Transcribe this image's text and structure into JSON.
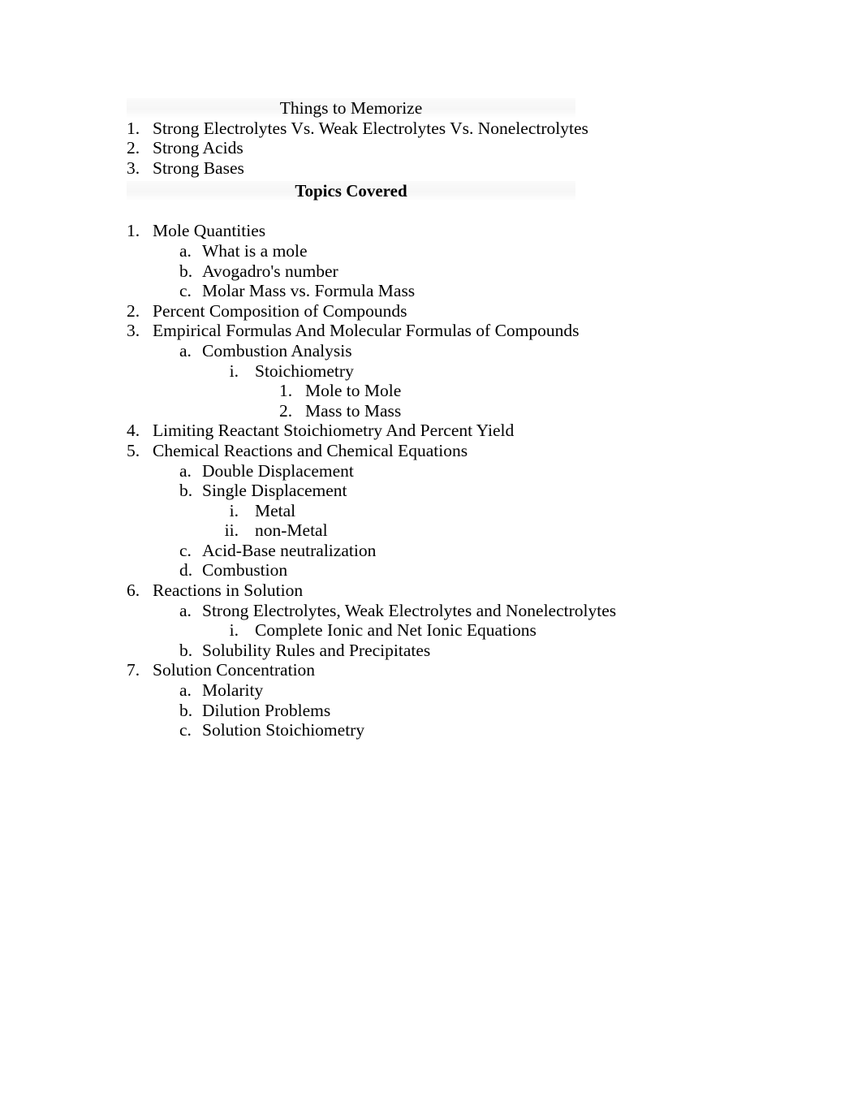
{
  "document": {
    "memorize_section": {
      "heading": "Things to Memorize",
      "items": [
        {
          "marker": "1.",
          "label": "Strong Electrolytes Vs. Weak Electrolytes Vs. Nonelectrolytes"
        },
        {
          "marker": "2.",
          "label": "Strong Acids"
        },
        {
          "marker": "3.",
          "label": "Strong Bases"
        }
      ]
    },
    "topics_section": {
      "heading": "Topics Covered",
      "items": [
        {
          "marker": "1.",
          "level": 1,
          "label": "Mole Quantities"
        },
        {
          "marker": "a.",
          "level": 2,
          "label": "What is a mole"
        },
        {
          "marker": "b.",
          "level": 2,
          "label": "Avogadro's number"
        },
        {
          "marker": "c.",
          "level": 2,
          "label": "Molar Mass vs. Formula Mass"
        },
        {
          "marker": "2.",
          "level": 1,
          "label": "Percent Composition of Compounds"
        },
        {
          "marker": "3.",
          "level": 1,
          "label": "Empirical Formulas And Molecular Formulas of Compounds"
        },
        {
          "marker": "a.",
          "level": 2,
          "label": "Combustion Analysis"
        },
        {
          "marker": "i.",
          "level": 3,
          "label": "Stoichiometry"
        },
        {
          "marker": "1.",
          "level": 4,
          "label": "Mole to Mole"
        },
        {
          "marker": "2.",
          "level": 4,
          "label": "Mass to Mass"
        },
        {
          "marker": "4.",
          "level": 1,
          "label": "Limiting Reactant Stoichiometry And Percent Yield"
        },
        {
          "marker": "5.",
          "level": 1,
          "label": "Chemical Reactions and Chemical Equations"
        },
        {
          "marker": "a.",
          "level": 2,
          "label": "Double Displacement"
        },
        {
          "marker": "b.",
          "level": 2,
          "label": "Single Displacement"
        },
        {
          "marker": "i.",
          "level": 3,
          "label": "Metal"
        },
        {
          "marker": "ii.",
          "level": 3,
          "label": "non-Metal"
        },
        {
          "marker": "c.",
          "level": 2,
          "label": "Acid-Base neutralization"
        },
        {
          "marker": "d.",
          "level": 2,
          "label": "Combustion"
        },
        {
          "marker": "6.",
          "level": 1,
          "label": "Reactions in Solution"
        },
        {
          "marker": "a.",
          "level": 2,
          "label": "Strong Electrolytes, Weak Electrolytes and Nonelectrolytes"
        },
        {
          "marker": "i.",
          "level": 3,
          "label": "Complete Ionic and Net Ionic Equations"
        },
        {
          "marker": "b.",
          "level": 2,
          "label": "Solubility Rules and Precipitates"
        },
        {
          "marker": "7.",
          "level": 1,
          "label": "Solution Concentration"
        },
        {
          "marker": "a.",
          "level": 2,
          "label": "Molarity"
        },
        {
          "marker": "b.",
          "level": 2,
          "label": "Dilution Problems"
        },
        {
          "marker": "c.",
          "level": 2,
          "label": "Solution Stoichiometry"
        }
      ]
    }
  }
}
